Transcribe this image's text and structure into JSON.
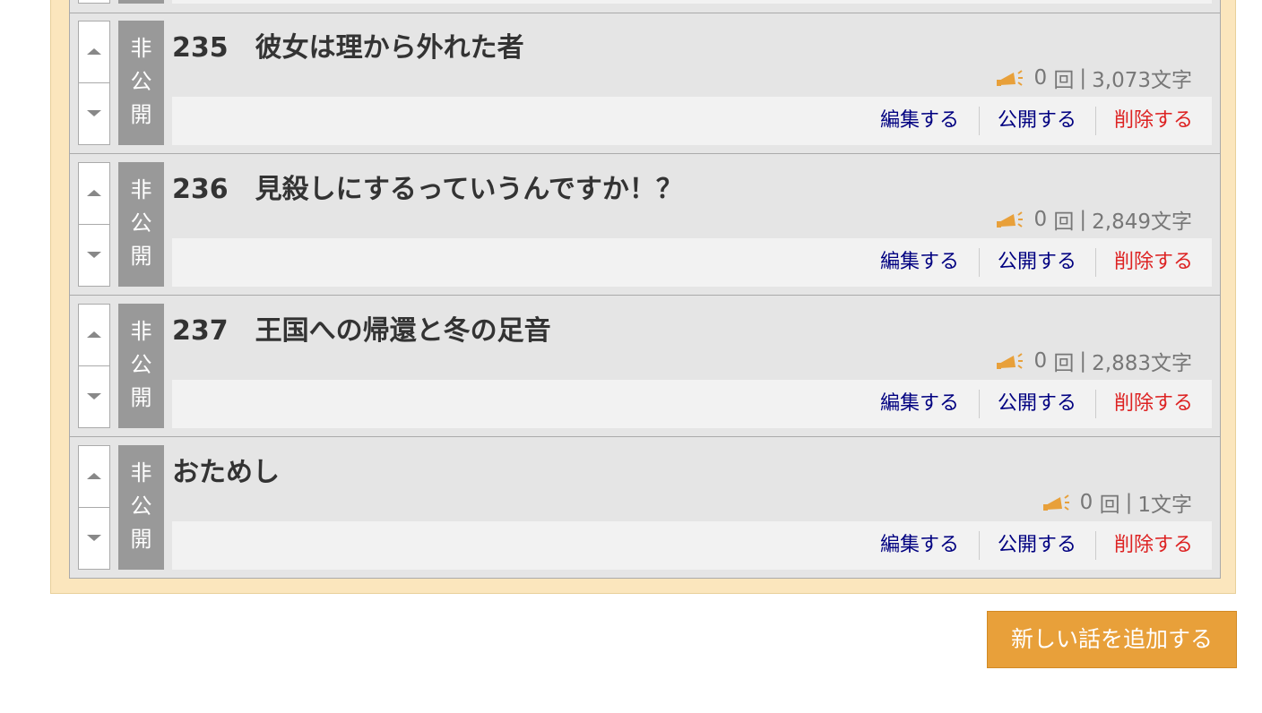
{
  "episodes": [
    {
      "title": "235　彼女は理から外れた者",
      "status": [
        "非",
        "公",
        "開"
      ],
      "count": "0",
      "count_unit": "回",
      "chars": "3,073文字"
    },
    {
      "title": "236　見殺しにするっていうんですか！？",
      "status": [
        "非",
        "公",
        "開"
      ],
      "count": "0",
      "count_unit": "回",
      "chars": "2,849文字"
    },
    {
      "title": "237　王国への帰還と冬の足音",
      "status": [
        "非",
        "公",
        "開"
      ],
      "count": "0",
      "count_unit": "回",
      "chars": "2,883文字"
    },
    {
      "title": "おためし",
      "status": [
        "非",
        "公",
        "開"
      ],
      "count": "0",
      "count_unit": "回",
      "chars": "1文字"
    }
  ],
  "actions": {
    "edit": "編集する",
    "publish": "公開する",
    "delete": "削除する"
  },
  "meta_separator": "|",
  "add_button": "新しい話を追加する",
  "icons": {
    "up": "chevron-up-icon",
    "down": "chevron-down-icon",
    "cheer": "megaphone-icon"
  },
  "colors": {
    "panel": "#fbe6bd",
    "status": "#999999",
    "link": "#000080",
    "delete": "#dd2222",
    "button": "#e8a03a",
    "icon": "#e8a03a"
  }
}
